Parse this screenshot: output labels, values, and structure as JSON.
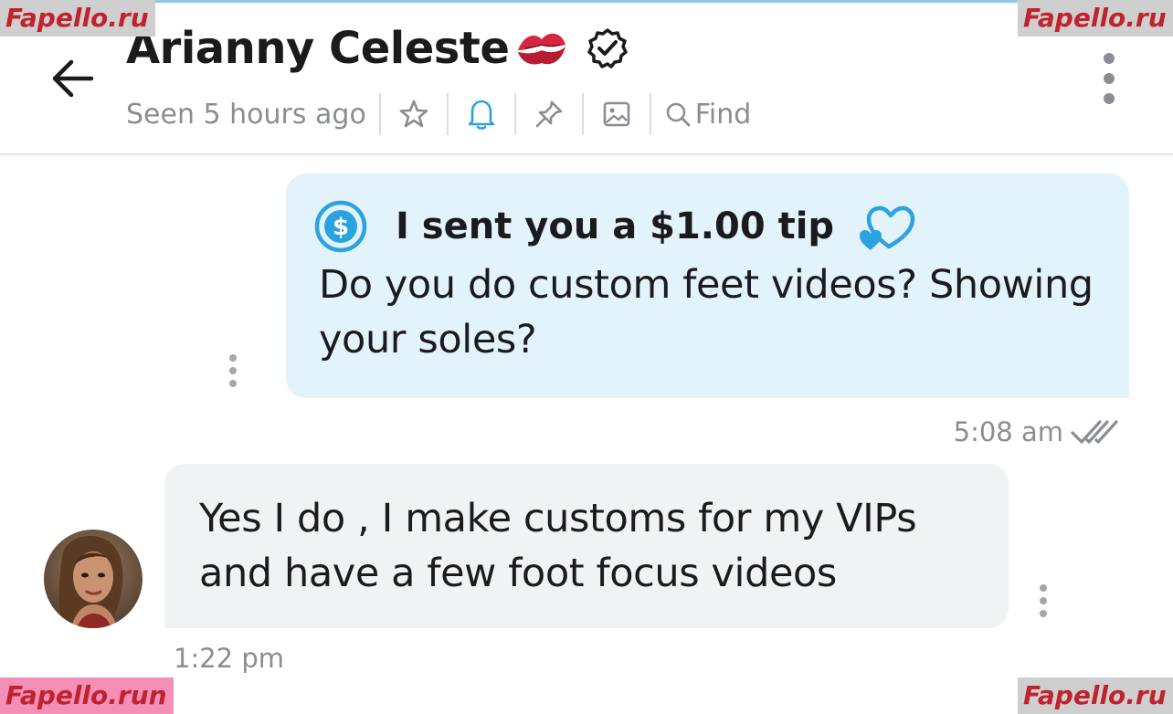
{
  "header": {
    "back_icon": "arrow-left-icon",
    "title": "Arianny Celeste",
    "title_emoji": "kiss-mark-icon",
    "verified_icon": "verified-badge-icon",
    "seen_status": "Seen 5 hours ago",
    "tools": [
      {
        "icon": "star-icon"
      },
      {
        "icon": "bell-icon",
        "color": "#2ba3e0"
      },
      {
        "icon": "pin-icon"
      },
      {
        "icon": "image-icon"
      }
    ],
    "find_label": "Find",
    "more_icon": "more-vertical-icon"
  },
  "messages": {
    "sent": {
      "tip_text": "I sent you a $1.00 tip",
      "tip_icon": "dollar-circle-icon",
      "hearts_icon": "hearts-icon",
      "text": "Do you do custom feet videos? Showing your soles?",
      "time": "5:08 am",
      "status_icon": "double-check-icon",
      "bubble_color": "#e3f3fc"
    },
    "received": {
      "text": "Yes I do , I make customs for my VIPs and have a few foot focus videos",
      "time": "1:22 pm",
      "bubble_color": "#f1f2f4"
    }
  },
  "watermarks": {
    "top_left": "Fapello.ru",
    "top_right": "Fapello.ru",
    "bottom_left": "Fapello.run",
    "bottom_right": "Fapello.ru"
  },
  "colors": {
    "accent": "#2ba3e0",
    "muted_text": "#8a8d93",
    "primary_text": "#1b1b1d",
    "watermark_red": "#c0232e"
  }
}
